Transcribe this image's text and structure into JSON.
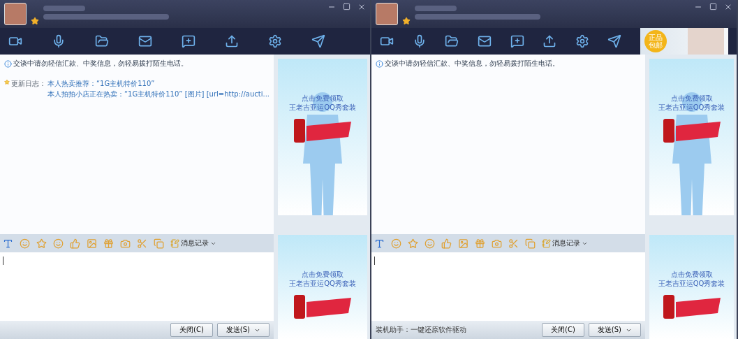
{
  "windows": [
    {
      "notice": "交谈中请勿轻信汇款、中奖信息，勿轻易拨打陌生电话。",
      "updates": {
        "label": "更新日志：",
        "lines": [
          "本人热卖推荐：“1G主机特价110”",
          "本人拍拍小店正在热卖：“1G主机特价110” [图片]  [url=http://aucti..."
        ]
      },
      "ads": [
        {
          "lines": [
            "点击免费领取",
            "王老吉亚运QQ秀套装"
          ]
        },
        {
          "lines": [
            "点击免费领取",
            "王老吉亚运QQ秀套装"
          ]
        }
      ],
      "history_button": "消息记录",
      "buttons": [
        {
          "label": "关闭(C)",
          "kind": "plain"
        },
        {
          "label": "发送(S)",
          "kind": "split"
        }
      ]
    },
    {
      "banner": {
        "label": "正品包邮"
      },
      "notice": "交谈中请勿轻信汇款、中奖信息，勿轻易拨打陌生电话。",
      "ads": [
        {
          "lines": [
            "点击免费领取",
            "王老吉亚运QQ秀套装"
          ]
        },
        {
          "lines": [
            "点击免费领取",
            "王老吉亚运QQ秀套装"
          ]
        }
      ],
      "history_button": "消息记录",
      "status_text": "装机助手：一键还原软件驱动",
      "buttons": [
        {
          "label": "关闭(C)",
          "kind": "plain"
        },
        {
          "label": "发送(S)",
          "kind": "split"
        }
      ]
    }
  ]
}
